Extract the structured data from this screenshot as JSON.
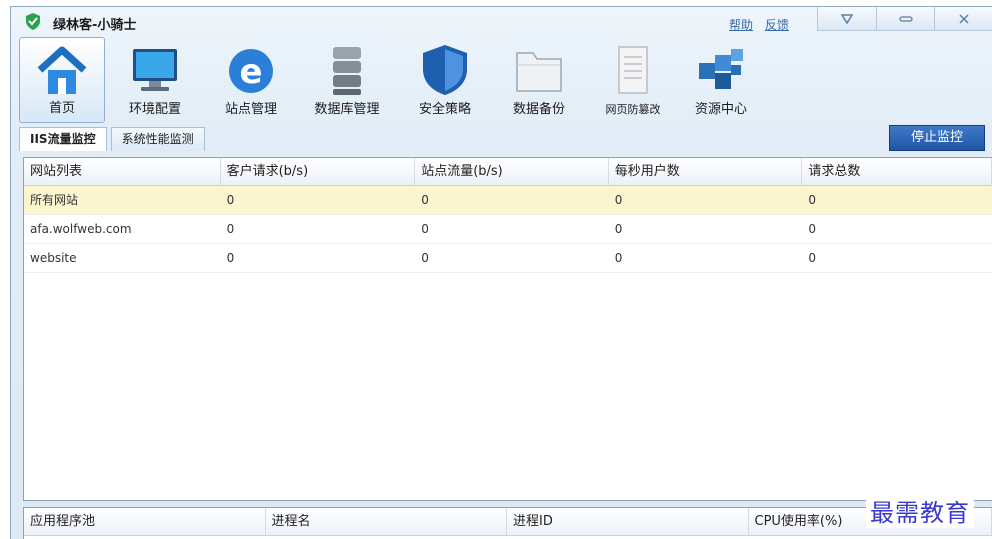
{
  "app": {
    "title": "绿林客-小骑士",
    "links": [
      "帮助",
      "反馈"
    ]
  },
  "window_controls": [
    "shield-menu",
    "minimize",
    "close"
  ],
  "toolbar": {
    "items": [
      {
        "label": "首页",
        "icon": "home-icon",
        "active": true
      },
      {
        "label": "环境配置",
        "icon": "monitor-icon"
      },
      {
        "label": "站点管理",
        "icon": "ie-globe-icon"
      },
      {
        "label": "数据库管理",
        "icon": "database-icon"
      },
      {
        "label": "安全策略",
        "icon": "shield-icon"
      },
      {
        "label": "数据备份",
        "icon": "folder-icon"
      },
      {
        "label": "网页防篡改",
        "icon": "document-icon"
      },
      {
        "label": "资源中心",
        "icon": "cubes-icon"
      }
    ]
  },
  "tabs": [
    {
      "label": "IIS流量监控",
      "active": true
    },
    {
      "label": "系统性能监测"
    }
  ],
  "stop_button": "停止监控",
  "table": {
    "headers": [
      "网站列表",
      "客户请求(b/s)",
      "站点流量(b/s)",
      "每秒用户数",
      "请求总数"
    ],
    "rows": [
      {
        "cells": [
          "所有网站",
          "0",
          "0",
          "0",
          "0"
        ],
        "selected": true
      },
      {
        "cells": [
          "afa.wolfweb.com",
          "0",
          "0",
          "0",
          "0"
        ]
      },
      {
        "cells": [
          "website",
          "0",
          "0",
          "0",
          "0"
        ]
      }
    ]
  },
  "bottom_table": {
    "headers": [
      "应用程序池",
      "进程名",
      "进程ID",
      "CPU使用率(%)"
    ]
  },
  "watermark": "最需教育"
}
